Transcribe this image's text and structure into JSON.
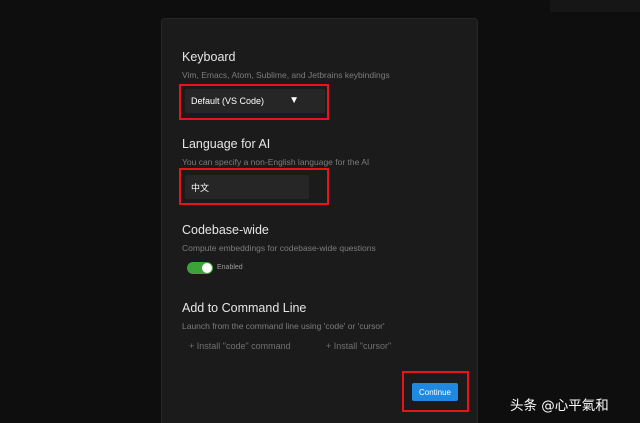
{
  "keyboard": {
    "title": "Keyboard",
    "description": "Vim, Emacs, Atom, Sublime, and Jetbrains keybindings",
    "selected": "Default (VS Code)",
    "arrow_icon": "▼"
  },
  "language": {
    "title": "Language for AI",
    "description": "You can specify a non-English language for the AI",
    "value": "中文"
  },
  "codebase": {
    "title": "Codebase-wide",
    "description": "Compute embeddings for codebase-wide questions",
    "toggle_label": "Enabled",
    "toggle_on": true
  },
  "command_line": {
    "title": "Add to Command Line",
    "description": "Launch from the command line using 'code' or 'cursor'",
    "install_code": "+ Install \"code\" command",
    "install_cursor": "+ Install \"cursor\""
  },
  "continue_label": "Continue",
  "watermark": "头条 @心平氣和",
  "colors": {
    "highlight": "#e8141a",
    "toggle_on": "#3ea23a",
    "primary_button": "#1f88e0"
  }
}
